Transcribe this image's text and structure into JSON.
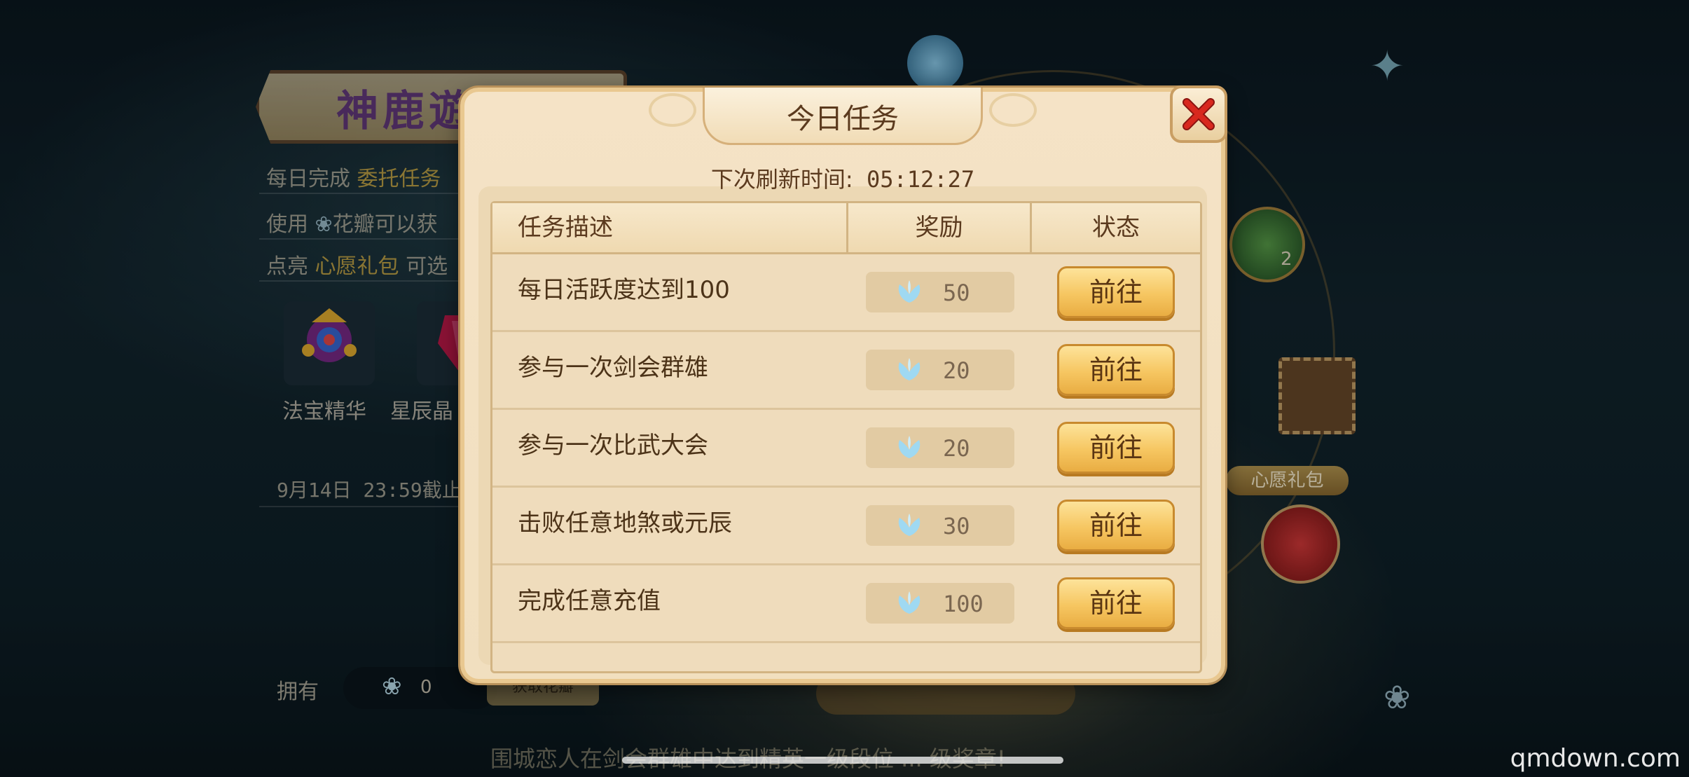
{
  "background": {
    "banner_title": "神鹿遊",
    "lines": [
      {
        "pre": "每日完成 ",
        "hl": "委托任务",
        "post": ""
      },
      {
        "pre": "使用 ",
        "hl": "",
        "post": "花瓣可以获"
      },
      {
        "pre": "点亮 ",
        "hl": "心愿礼包",
        "post": " 可选"
      }
    ],
    "items": [
      {
        "label": "法宝精华",
        "icon": "magic-treasure-icon"
      },
      {
        "label": "星辰晶",
        "icon": "star-crystal-icon"
      }
    ],
    "deadline": "9月14日  23:59截止",
    "owned_label": "拥有",
    "owned_count": "0",
    "owned_button": "获取花瓣",
    "bottom_text": "围城恋人在剑会群雄中达到精英一级段位  ...  级奖章!",
    "wish_gift_label": "心愿礼包",
    "side_badge": "2"
  },
  "modal": {
    "title": "今日任务",
    "refresh_label": "下次刷新时间:",
    "refresh_time": "05:12:27",
    "headers": {
      "desc": "任务描述",
      "reward": "奖励",
      "status": "状态"
    },
    "tasks": [
      {
        "desc": "每日活跃度达到100",
        "reward": "50",
        "action": "前往"
      },
      {
        "desc": "参与一次剑会群雄",
        "reward": "20",
        "action": "前往"
      },
      {
        "desc": "参与一次比武大会",
        "reward": "20",
        "action": "前往"
      },
      {
        "desc": "击败任意地煞或元辰",
        "reward": "30",
        "action": "前往"
      },
      {
        "desc": "完成任意充值",
        "reward": "100",
        "action": "前往"
      }
    ],
    "reward_icon": "petal-icon",
    "close_icon": "close-icon"
  },
  "watermark": "qmdown.com",
  "colors": {
    "modal_bg": "#f5e3c6",
    "button_gold": "#f6c661",
    "close_red": "#c8281e",
    "text_brown": "#5b3a1e"
  }
}
